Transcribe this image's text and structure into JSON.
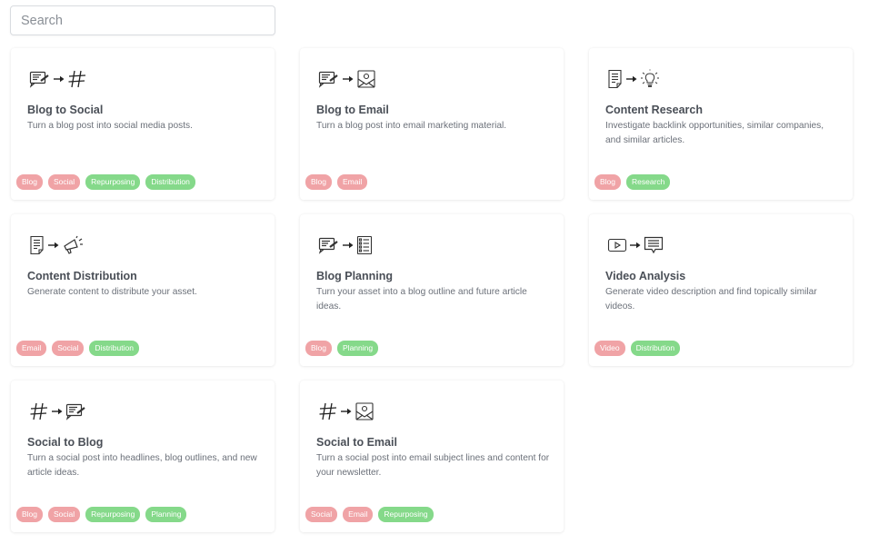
{
  "search": {
    "placeholder": "Search",
    "value": ""
  },
  "colors": {
    "tag_red": "#f0a3a6",
    "tag_green": "#85d98a"
  },
  "cards": [
    {
      "title": "Blog to Social",
      "description": "Turn a blog post into social media posts.",
      "icons": [
        "blog-post-icon",
        "arrow-right-icon",
        "hashtag-icon"
      ],
      "tags": [
        {
          "label": "Blog",
          "color": "red"
        },
        {
          "label": "Social",
          "color": "red"
        },
        {
          "label": "Repurposing",
          "color": "green"
        },
        {
          "label": "Distribution",
          "color": "green"
        }
      ]
    },
    {
      "title": "Blog to Email",
      "description": "Turn a blog post into email marketing material.",
      "icons": [
        "blog-post-icon",
        "arrow-right-icon",
        "email-icon"
      ],
      "tags": [
        {
          "label": "Blog",
          "color": "red"
        },
        {
          "label": "Email",
          "color": "red"
        }
      ]
    },
    {
      "title": "Content Research",
      "description": "Investigate backlink opportunities, similar companies, and similar articles.",
      "icons": [
        "document-icon",
        "arrow-right-icon",
        "lightbulb-icon"
      ],
      "tags": [
        {
          "label": "Blog",
          "color": "red"
        },
        {
          "label": "Research",
          "color": "green"
        }
      ]
    },
    {
      "title": "Content Distribution",
      "description": "Generate content to distribute your asset.",
      "icons": [
        "document-icon",
        "arrow-right-icon",
        "megaphone-icon"
      ],
      "tags": [
        {
          "label": "Email",
          "color": "red"
        },
        {
          "label": "Social",
          "color": "red"
        },
        {
          "label": "Distribution",
          "color": "green"
        }
      ]
    },
    {
      "title": "Blog Planning",
      "description": "Turn your asset into a blog outline and future article ideas.",
      "icons": [
        "blog-post-icon",
        "arrow-right-icon",
        "checklist-icon"
      ],
      "tags": [
        {
          "label": "Blog",
          "color": "red"
        },
        {
          "label": "Planning",
          "color": "green"
        }
      ]
    },
    {
      "title": "Video Analysis",
      "description": "Generate video description and find topically similar videos.",
      "icons": [
        "video-icon",
        "arrow-right-icon",
        "comment-icon"
      ],
      "tags": [
        {
          "label": "Video",
          "color": "red"
        },
        {
          "label": "Distribution",
          "color": "green"
        }
      ]
    },
    {
      "title": "Social to Blog",
      "description": "Turn a social post into headlines, blog outlines, and new article ideas.",
      "icons": [
        "hashtag-icon",
        "arrow-right-icon",
        "blog-post-icon"
      ],
      "tags": [
        {
          "label": "Blog",
          "color": "red"
        },
        {
          "label": "Social",
          "color": "red"
        },
        {
          "label": "Repurposing",
          "color": "green"
        },
        {
          "label": "Planning",
          "color": "green"
        }
      ]
    },
    {
      "title": "Social to Email",
      "description": "Turn a social post into email subject lines and content for your newsletter.",
      "icons": [
        "hashtag-icon",
        "arrow-right-icon",
        "email-icon"
      ],
      "tags": [
        {
          "label": "Social",
          "color": "red"
        },
        {
          "label": "Email",
          "color": "red"
        },
        {
          "label": "Repurposing",
          "color": "green"
        }
      ]
    }
  ]
}
